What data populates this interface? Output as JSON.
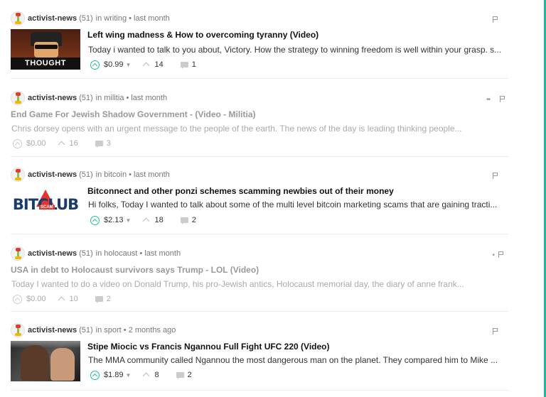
{
  "posts": [
    {
      "author": "activist-news",
      "reputation": "(51)",
      "meta": "in writing • last month",
      "title": "Left wing madness & How to overcoming tyranny (Video)",
      "excerpt": "Today i wanted to talk to you about, Victory. How the strategy to winning freedom is well within your grasp. s...",
      "payout": "$0.99",
      "votes": "14",
      "comments": "1",
      "thumbnail_caption": "THOUGHT POLICE",
      "muted": false
    },
    {
      "author": "activist-news",
      "reputation": "(51)",
      "meta": "in militia • last month",
      "title": "End Game For Jewish Shadow Government - (Video - Militia)",
      "excerpt": "Chris dorsey opens with an urgent message to the people of the earth. The news of the day is leading thinking people...",
      "payout": "$0.00",
      "votes": "16",
      "comments": "3",
      "muted": true
    },
    {
      "author": "activist-news",
      "reputation": "(51)",
      "meta": "in bitcoin • last month",
      "title": "Bitconnect and other ponzi schemes scamming newbies out of their money",
      "excerpt": "Hi folks, Today I wanted to talk about some of the multi level bitcoin marketing scams that are gaining tracti...",
      "payout": "$2.13",
      "votes": "18",
      "comments": "2",
      "thumbnail_caption": "BITCLUB",
      "thumbnail_badge": "SCAM",
      "muted": false
    },
    {
      "author": "activist-news",
      "reputation": "(51)",
      "meta": "in holocaust • last month",
      "title": "USA in debt to Holocaust survivors says Trump - LOL (Video)",
      "excerpt": "Today I wanted to do a video on Donald Trump, his pro-Jewish antics, Holocaust memorial day, the diary of anne frank...",
      "payout": "$0.00",
      "votes": "10",
      "comments": "2",
      "muted": true
    },
    {
      "author": "activist-news",
      "reputation": "(51)",
      "meta": "in sport • 2 months ago",
      "title": "Stipe Miocic vs Francis Ngannou Full Fight UFC 220 (Video)",
      "excerpt": "The MMA community called Ngannou the most dangerous man on the planet. They compared him to Mike ...",
      "payout": "$1.89",
      "votes": "8",
      "comments": "2",
      "muted": false
    }
  ],
  "colors": {
    "accent": "#1abc9c",
    "muted_text": "#999999"
  },
  "icons": [
    "avatar-icon",
    "flag-icon",
    "upvote-icon",
    "chevron-up-icon",
    "comment-icon",
    "caret-down-icon"
  ]
}
